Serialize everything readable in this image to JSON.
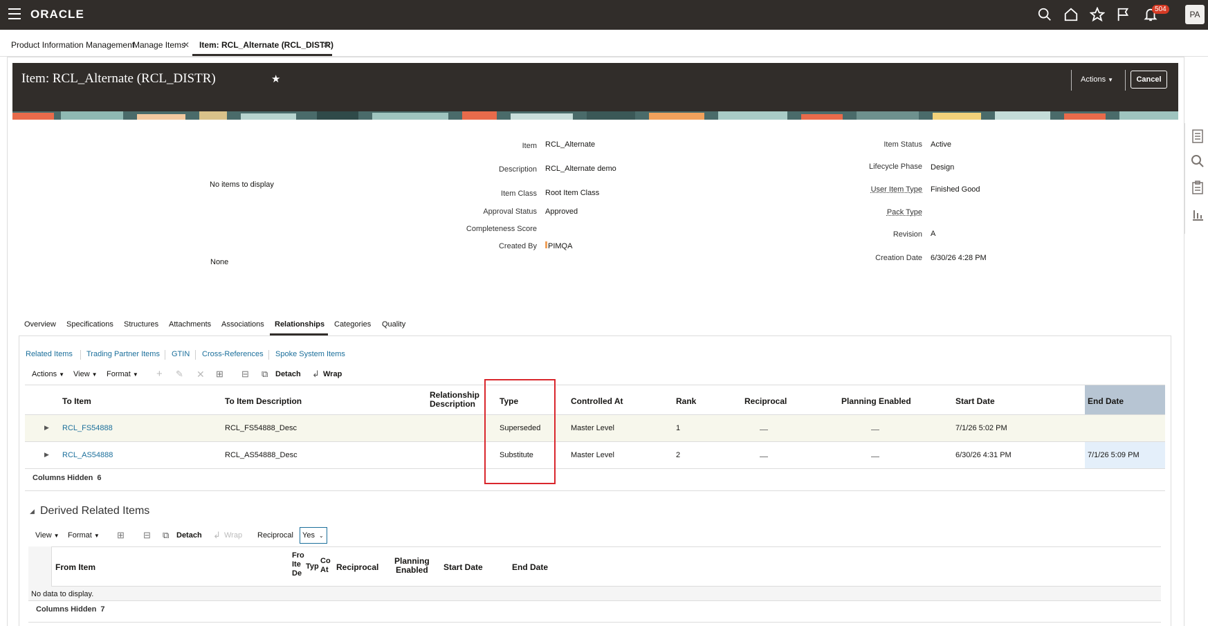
{
  "topbar": {
    "logo": "ORACLE",
    "notification_count": "504",
    "avatar_initials": "PA"
  },
  "page_tabs": [
    {
      "label": "Product Information Management"
    },
    {
      "label": "Manage Items"
    },
    {
      "label": "Item: RCL_Alternate (RCL_DISTR)"
    }
  ],
  "header": {
    "title": "Item: RCL_Alternate (RCL_DISTR)",
    "actions_label": "Actions",
    "cancel_label": "Cancel"
  },
  "summary": {
    "no_items": "No items to display",
    "none": "None",
    "fields_mid": [
      {
        "label": "Item",
        "value": "RCL_Alternate"
      },
      {
        "label": "Description",
        "value": "RCL_Alternate demo"
      },
      {
        "label": "Item Class",
        "value": "Root Item Class"
      },
      {
        "label": "Approval Status",
        "value": "Approved"
      },
      {
        "label": "Completeness Score",
        "value": ""
      },
      {
        "label": "Created By",
        "value": "PIMQA"
      }
    ],
    "fields_right": [
      {
        "label": "Item Status",
        "value": "Active"
      },
      {
        "label": "Lifecycle Phase",
        "value": "Design"
      },
      {
        "label": "User Item Type",
        "value": "Finished Good"
      },
      {
        "label": "Pack Type",
        "value": ""
      },
      {
        "label": "Revision",
        "value": "A"
      },
      {
        "label": "Creation Date",
        "value": "6/30/26 4:28 PM"
      }
    ]
  },
  "item_tabs": [
    "Overview",
    "Specifications",
    "Structures",
    "Attachments",
    "Associations",
    "Relationships",
    "Categories",
    "Quality"
  ],
  "sub_links": [
    "Related Items",
    "Trading Partner Items",
    "GTIN",
    "Cross-References",
    "Spoke System Items"
  ],
  "toolbar": {
    "actions": "Actions",
    "view": "View",
    "format": "Format",
    "detach": "Detach",
    "wrap": "Wrap"
  },
  "related_table": {
    "headers": {
      "to_item": "To Item",
      "to_item_desc": "To Item Description",
      "rel_desc_1": "Relationship",
      "rel_desc_2": "Description",
      "type": "Type",
      "controlled_at": "Controlled At",
      "rank": "Rank",
      "reciprocal": "Reciprocal",
      "planning_enabled": "Planning Enabled",
      "start_date": "Start Date",
      "end_date": "End Date"
    },
    "rows": [
      {
        "to_item": "RCL_FS54888",
        "desc": "RCL_FS54888_Desc",
        "type": "Superseded",
        "controlled_at": "Master Level",
        "rank": "1",
        "start_date": "7/1/26 5:02 PM",
        "end_date": ""
      },
      {
        "to_item": "RCL_AS54888",
        "desc": "RCL_AS54888_Desc",
        "type": "Substitute",
        "controlled_at": "Master Level",
        "rank": "2",
        "start_date": "6/30/26 4:31 PM",
        "end_date": "7/1/26 5:09 PM"
      }
    ],
    "columns_hidden_label": "Columns Hidden",
    "columns_hidden_count": "6"
  },
  "derived": {
    "title": "Derived Related Items",
    "view": "View",
    "format": "Format",
    "detach": "Detach",
    "wrap": "Wrap",
    "reciprocal_label": "Reciprocal",
    "reciprocal_value": "Yes",
    "headers": {
      "from_item": "From Item",
      "fro_1": "Fro",
      "fro_2": "Ite",
      "fro_3": "De",
      "typ": "Typ",
      "co_1": "Co",
      "co_2": "At",
      "reciprocal": "Reciprocal",
      "planning_1": "Planning",
      "planning_2": "Enabled",
      "start_date": "Start Date",
      "end_date": "End Date"
    },
    "no_data": "No data to display.",
    "columns_hidden_label": "Columns Hidden",
    "columns_hidden_count": "7"
  }
}
